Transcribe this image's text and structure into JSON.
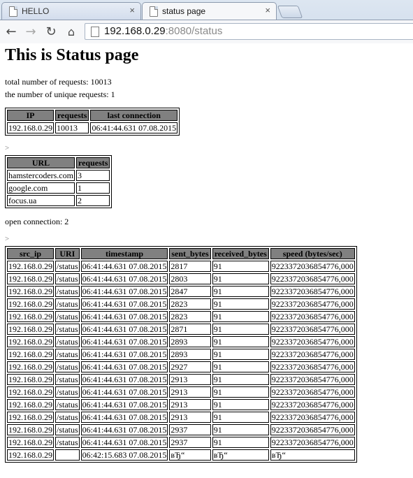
{
  "browser": {
    "tabs": [
      {
        "title": "HELLO",
        "close": "×",
        "active": false
      },
      {
        "title": "status page",
        "close": "×",
        "active": true
      }
    ],
    "nav": {
      "back": "←",
      "forward": "→",
      "reload": "↻",
      "home": "⌂"
    },
    "address": {
      "host": "192.168.0.29",
      "rest": ":8080/status"
    }
  },
  "page": {
    "heading": "This is Status page",
    "total_requests": "total number of requests: 10013",
    "unique_requests": "the number of unique requests: 1",
    "separator_1": ">",
    "open_connections": "open connection: 2",
    "separator_2": ">",
    "ip_table": {
      "headers": [
        "IP",
        "requests",
        "last connection"
      ],
      "rows": [
        [
          "192.168.0.29",
          "10013",
          "06:41:44.631 07.08.2015"
        ]
      ]
    },
    "url_table": {
      "headers": [
        "URL",
        "requests"
      ],
      "rows": [
        [
          "hamstercoders.com",
          "3"
        ],
        [
          "google.com",
          "1"
        ],
        [
          "focus.ua",
          "2"
        ]
      ]
    },
    "conn_table": {
      "headers": [
        "src_ip",
        "URI",
        "timestamp",
        "sent_bytes",
        "received_bytes",
        "speed (bytes/sec)"
      ],
      "rows": [
        [
          "192.168.0.29",
          "/status",
          "06:41:44.631 07.08.2015",
          "2817",
          "91",
          "9223372036854776,000"
        ],
        [
          "192.168.0.29",
          "/status",
          "06:41:44.631 07.08.2015",
          "2803",
          "91",
          "9223372036854776,000"
        ],
        [
          "192.168.0.29",
          "/status",
          "06:41:44.631 07.08.2015",
          "2847",
          "91",
          "9223372036854776,000"
        ],
        [
          "192.168.0.29",
          "/status",
          "06:41:44.631 07.08.2015",
          "2823",
          "91",
          "9223372036854776,000"
        ],
        [
          "192.168.0.29",
          "/status",
          "06:41:44.631 07.08.2015",
          "2823",
          "91",
          "9223372036854776,000"
        ],
        [
          "192.168.0.29",
          "/status",
          "06:41:44.631 07.08.2015",
          "2871",
          "91",
          "9223372036854776,000"
        ],
        [
          "192.168.0.29",
          "/status",
          "06:41:44.631 07.08.2015",
          "2893",
          "91",
          "9223372036854776,000"
        ],
        [
          "192.168.0.29",
          "/status",
          "06:41:44.631 07.08.2015",
          "2893",
          "91",
          "9223372036854776,000"
        ],
        [
          "192.168.0.29",
          "/status",
          "06:41:44.631 07.08.2015",
          "2927",
          "91",
          "9223372036854776,000"
        ],
        [
          "192.168.0.29",
          "/status",
          "06:41:44.631 07.08.2015",
          "2913",
          "91",
          "9223372036854776,000"
        ],
        [
          "192.168.0.29",
          "/status",
          "06:41:44.631 07.08.2015",
          "2913",
          "91",
          "9223372036854776,000"
        ],
        [
          "192.168.0.29",
          "/status",
          "06:41:44.631 07.08.2015",
          "2913",
          "91",
          "9223372036854776,000"
        ],
        [
          "192.168.0.29",
          "/status",
          "06:41:44.631 07.08.2015",
          "2913",
          "91",
          "9223372036854776,000"
        ],
        [
          "192.168.0.29",
          "/status",
          "06:41:44.631 07.08.2015",
          "2937",
          "91",
          "9223372036854776,000"
        ],
        [
          "192.168.0.29",
          "/status",
          "06:41:44.631 07.08.2015",
          "2937",
          "91",
          "9223372036854776,000"
        ],
        [
          "192.168.0.29",
          "",
          "06:42:15.683 07.08.2015",
          "вЂ“",
          "вЂ“",
          "вЂ“"
        ]
      ]
    }
  }
}
